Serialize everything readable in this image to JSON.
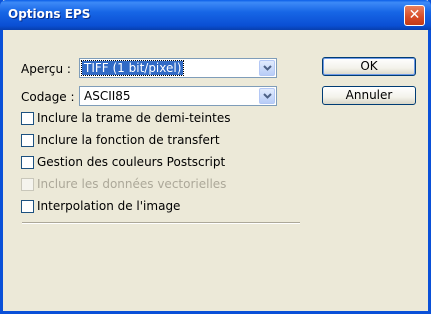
{
  "window": {
    "title": "Options EPS",
    "close_glyph": "✕"
  },
  "apercu": {
    "label": "Aperçu :",
    "value": "TIFF (1 bit/pixel)"
  },
  "codage": {
    "label": "Codage :",
    "value": "ASCII85"
  },
  "buttons": {
    "ok": "OK",
    "annuler": "Annuler"
  },
  "options": [
    {
      "label": "Inclure la trame de demi-teintes",
      "checked": false,
      "enabled": true
    },
    {
      "label": "Inclure la fonction de transfert",
      "checked": false,
      "enabled": true
    },
    {
      "label": "Gestion des couleurs Postscript",
      "checked": false,
      "enabled": true
    },
    {
      "label": "Inclure les données vectorielles",
      "checked": false,
      "enabled": false
    },
    {
      "label": "Interpolation de l'image",
      "checked": false,
      "enabled": true
    }
  ],
  "icons": {
    "dropdown": "chevron-down-icon",
    "close": "close-icon"
  },
  "colors": {
    "title_bar": "#0a50d8",
    "dialog_bg": "#ece9d8",
    "selection": "#316ac5"
  }
}
